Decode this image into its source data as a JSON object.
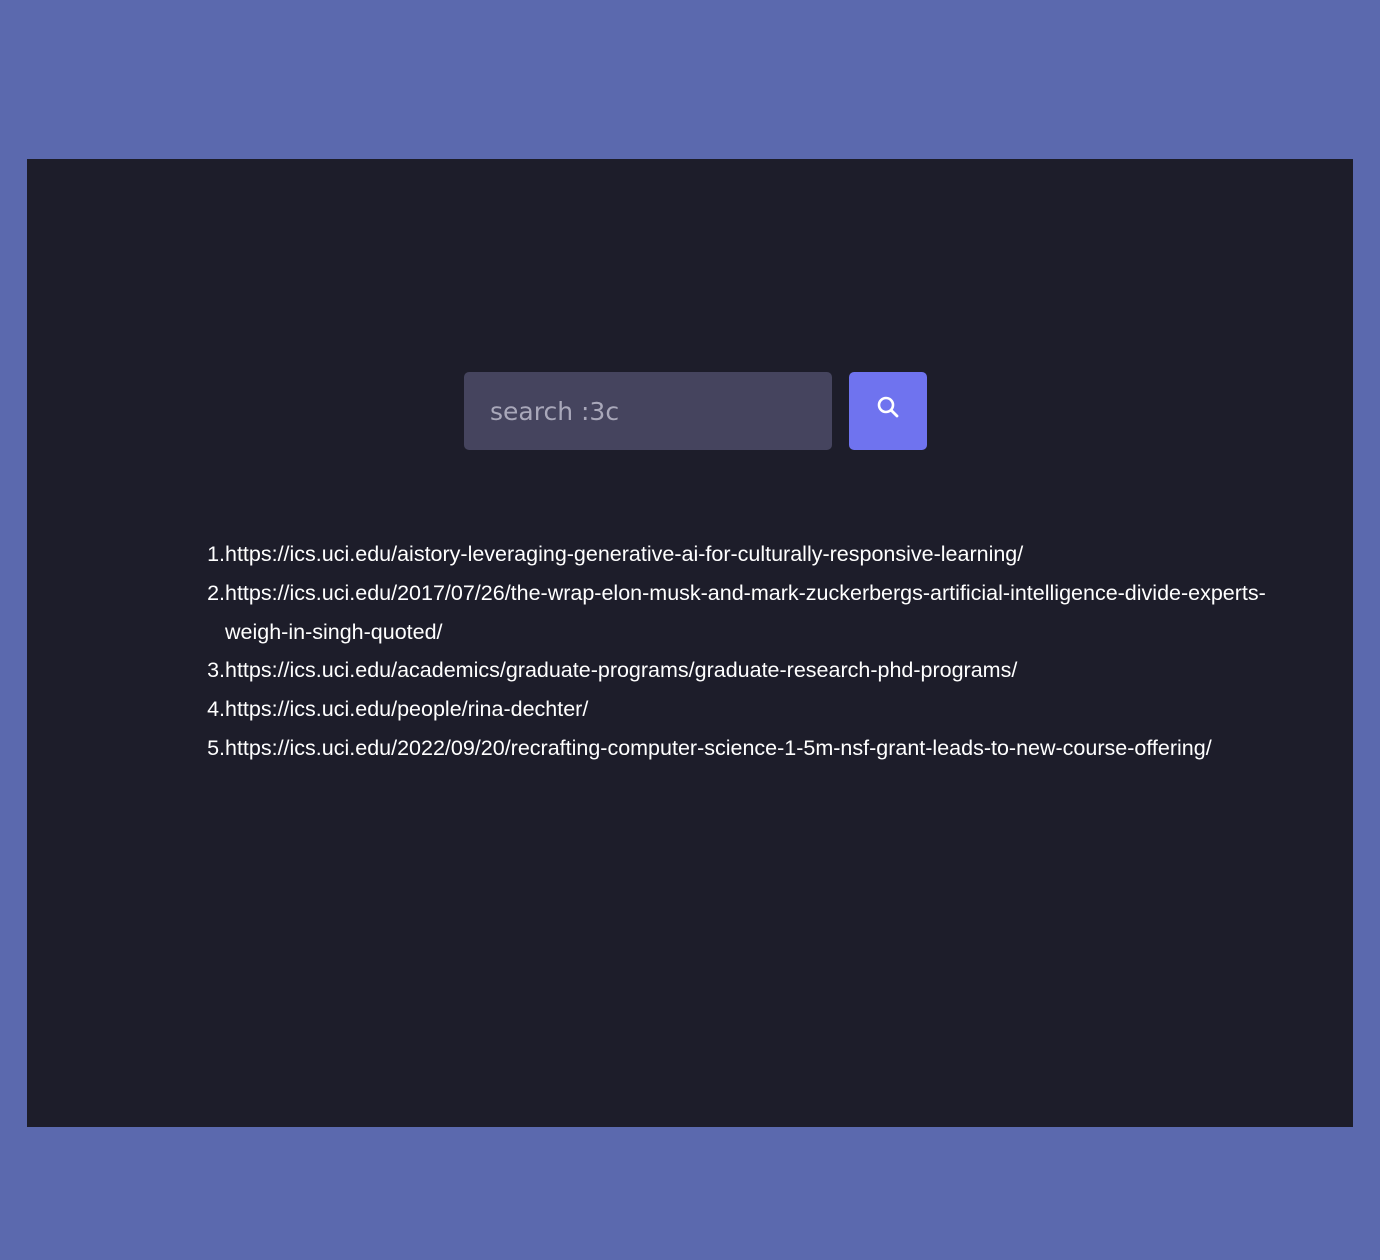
{
  "search": {
    "placeholder": "search :3c",
    "value": "",
    "button_icon": "search-icon"
  },
  "results": [
    {
      "number": "1.",
      "url": "https://ics.uci.edu/aistory-leveraging-generative-ai-for-culturally-responsive-learning/"
    },
    {
      "number": "2.",
      "url": "https://ics.uci.edu/2017/07/26/the-wrap-elon-musk-and-mark-zuckerbergs-artificial-intelligence-divide-experts-weigh-in-singh-quoted/"
    },
    {
      "number": "3.",
      "url": "https://ics.uci.edu/academics/graduate-programs/graduate-research-phd-programs/"
    },
    {
      "number": "4.",
      "url": "https://ics.uci.edu/people/rina-dechter/"
    },
    {
      "number": "5.",
      "url": "https://ics.uci.edu/2022/09/20/recrafting-computer-science-1-5m-nsf-grant-leads-to-new-course-offering/"
    }
  ],
  "colors": {
    "background": "#5b69ae",
    "panel": "#1d1d2a",
    "input": "#45445e",
    "accent": "#6f73ef",
    "text": "#ffffff"
  }
}
